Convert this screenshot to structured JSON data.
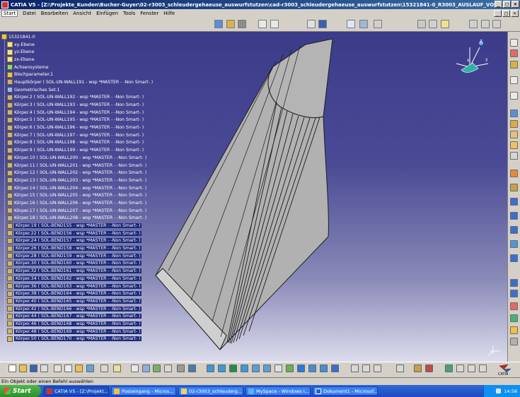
{
  "window": {
    "title": "CATIA V5 - [Z:\\Projekte_Kunden\\Bucher-Guyer\\02-r3003_schleudergehaeuse_auswurfstutzen\\cad-r3003_schleudergehaeuse_auswurfstutzen\\15321841-0_R3003_AUSLAUF_VORN]",
    "buttons": [
      "_",
      "□",
      "×"
    ]
  },
  "menubar": {
    "items": [
      "Start",
      "Datei",
      "Bearbeiten",
      "Ansicht",
      "Einfügen",
      "Tools",
      "Fenster",
      "Hilfe"
    ],
    "active_index": 0
  },
  "tree": {
    "root": "15321841-0",
    "planes": [
      "xy-Ebene",
      "yz-Ebene",
      "zx-Ebene"
    ],
    "items": [
      "Achsensysteme",
      "Blechparameter.1",
      "Hauptkörper ( SOL-UN-WALL191 - wsp *MASTER - -Non Smart- )",
      "Geometrisches Set.1",
      "Körper.2 ( SOL-UN-WALL192 - wsp *MASTER - -Non Smart- )",
      "Körper.3 ( SOL-UN-WALL193 - wsp *MASTER - -Non Smart- )",
      "Körper.4 ( SOL-UN-WALL194 - wsp *MASTER - -Non Smart- )",
      "Körper.5 ( SOL-UN-WALL195 - wsp *MASTER - -Non Smart- )",
      "Körper.6 ( SOL-UN-WALL196 - wsp *MASTER - -Non Smart- )",
      "Körper.7 ( SOL-UN-WALL197 - wsp *MASTER - -Non Smart- )",
      "Körper.8 ( SOL-UN-WALL198 - wsp *MASTER - -Non Smart- )",
      "Körper.9 ( SOL-UN-WALL199 - wsp *MASTER - -Non Smart- )",
      "Körper.10 ( SOL-UN-WALL200 - wsp *MASTER - -Non Smart- )",
      "Körper.11 ( SOL-UN-WALL201 - wsp *MASTER - -Non Smart- )",
      "Körper.12 ( SOL-UN-WALL202 - wsp *MASTER - -Non Smart- )",
      "Körper.13 ( SOL-UN-WALL203 - wsp *MASTER - -Non Smart- )",
      "Körper.14 ( SOL-UN-WALL204 - wsp *MASTER - -Non Smart- )",
      "Körper.15 ( SOL-UN-WALL205 - wsp *MASTER - -Non Smart- )",
      "Körper.16 ( SOL-UN-WALL206 - wsp *MASTER - -Non Smart- )",
      "Körper.17 ( SOL-UN-WALL207 - wsp *MASTER - -Non Smart- )",
      "Körper.18 ( SOL-UN-WALL208 - wsp *MASTER - -Non Smart- )",
      "Körper.19 ( SOL-BEND155 - wsp *MASTER - -Non Smart- )",
      "Körper.22 ( SOL-BEND156 - wsp *MASTER - -Non Smart- )",
      "Körper.24 ( SOL-BEND157 - wsp *MASTER - -Non Smart- )",
      "Körper.26 ( SOL-BEND158 - wsp *MASTER - -Non Smart- )",
      "Körper.28 ( SOL-BEND159 - wsp *MASTER - -Non Smart- )",
      "Körper.30 ( SOL-BEND160 - wsp *MASTER - -Non Smart- )",
      "Körper.32 ( SOL-BEND161 - wsp *MASTER - -Non Smart- )",
      "Körper.34 ( SOL-BEND162 - wsp *MASTER - -Non Smart- )",
      "Körper.36 ( SOL-BEND163 - wsp *MASTER - -Non Smart- )",
      "Körper.38 ( SOL-BEND164 - wsp *MASTER - -Non Smart- )",
      "Körper.40 ( SOL-BEND165 - wsp *MASTER - -Non Smart- )",
      "Körper.42 ( SOL-BEND166 - wsp *MASTER - -Non Smart- )",
      "Körper.44 ( SOL-BEND167 - wsp *MASTER - -Non Smart- )",
      "Körper.46 ( SOL-BEND168 - wsp *MASTER - -Non Smart- )",
      "Körper.48 ( SOL-BEND169 - wsp *MASTER - -Non Smart- )",
      "Körper.50 ( SOL-BEND170 - wsp *MASTER - -Non Smart- )"
    ]
  },
  "compass": {
    "label_z": "z",
    "label_x": "x",
    "label_y": "y"
  },
  "statusbar": {
    "text": "Ein Objekt oder einen Befehl auswählen"
  },
  "taskbar": {
    "start_label": "Start",
    "items": [
      "CATIA V5 - [Z:\\Projekt...",
      "Posteingang - Micros...",
      "02-r3003_schleuderg...",
      "MySpace - Windows I...",
      "Dokument1 - Microsof..."
    ],
    "active_index": 0,
    "clock": "14:58"
  },
  "logo": {
    "text": "CATIA"
  },
  "colors": {
    "title_start": "#0a246a",
    "title_end": "#3a6ea5",
    "viewport_top": "#3b3b8a",
    "viewport_bottom": "#dcdcec",
    "part_gray": "#b4b4b4",
    "taskbar_blue": "#2a5fd0",
    "start_green": "#3ea23a"
  }
}
